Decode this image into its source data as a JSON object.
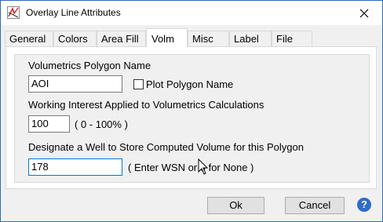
{
  "window": {
    "title": "Overlay Line Attributes"
  },
  "tabs": [
    {
      "label": "General"
    },
    {
      "label": "Colors"
    },
    {
      "label": "Area Fill"
    },
    {
      "label": "Volm"
    },
    {
      "label": "Misc"
    },
    {
      "label": "Label"
    },
    {
      "label": "File"
    }
  ],
  "active_tab": "Volm",
  "volm": {
    "polygon_name_label": "Volumetrics Polygon Name",
    "polygon_name_value": "AOI",
    "plot_polygon_name_label": "Plot Polygon Name",
    "plot_polygon_name_checked": false,
    "working_interest_label": "Working Interest Applied to Volumetrics Calculations",
    "working_interest_value": "100",
    "working_interest_hint": "( 0 - 100% )",
    "well_label": "Designate a Well to Store Computed Volume for this Polygon",
    "well_value": "178",
    "well_hint": "( Enter WSN or 0 for None )"
  },
  "buttons": {
    "ok": "Ok",
    "cancel": "Cancel",
    "help": "?"
  },
  "colors": {
    "accent": "#0078d7",
    "help": "#2f6cc8",
    "button": "#e1e1e1"
  }
}
